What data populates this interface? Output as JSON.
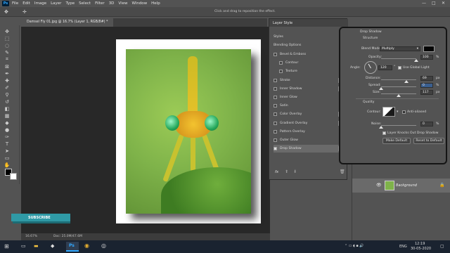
{
  "menu": {
    "logo": "Ps",
    "items": [
      "File",
      "Edit",
      "Image",
      "Layer",
      "Type",
      "Select",
      "Filter",
      "3D",
      "View",
      "Window",
      "Help"
    ],
    "window_controls": [
      "—",
      "□",
      "✕"
    ]
  },
  "options_bar": {
    "hint": "Click and drag to reposition the effect."
  },
  "document_tab": {
    "label": "Damsel Fly 01.jpg @ 16.7% (Layer 1, RGB/8#) *"
  },
  "status_bar": {
    "zoom": "16.67%",
    "doc": "Doc: 25.0M/47.6M"
  },
  "overlay": {
    "subscribe": "SUBSCRIBE"
  },
  "dialog": {
    "title": "Layer Style",
    "styles_header": "Styles",
    "blending_options": "Blending Options",
    "items": [
      {
        "label": "Bevel & Emboss",
        "checked": false,
        "plus": false
      },
      {
        "label": "Contour",
        "checked": false,
        "plus": false,
        "indent": true
      },
      {
        "label": "Texture",
        "checked": false,
        "plus": false,
        "indent": true
      },
      {
        "label": "Stroke",
        "checked": false,
        "plus": true
      },
      {
        "label": "Inner Shadow",
        "checked": false,
        "plus": true
      },
      {
        "label": "Inner Glow",
        "checked": false,
        "plus": false
      },
      {
        "label": "Satin",
        "checked": false,
        "plus": false
      },
      {
        "label": "Color Overlay",
        "checked": false,
        "plus": true
      },
      {
        "label": "Gradient Overlay",
        "checked": false,
        "plus": true
      },
      {
        "label": "Pattern Overlay",
        "checked": false,
        "plus": false
      },
      {
        "label": "Outer Glow",
        "checked": false,
        "plus": false
      },
      {
        "label": "Drop Shadow",
        "checked": true,
        "plus": true
      }
    ],
    "fx": "fx"
  },
  "drop_shadow": {
    "title": "Drop Shadow",
    "structure": "Structure",
    "blend_mode_label": "Blend Mode:",
    "blend_mode_value": "Multiply",
    "shadow_color": "#050505",
    "opacity_label": "Opacity:",
    "opacity_value": "100",
    "opacity_fraction": 1.0,
    "angle_label": "Angle:",
    "angle_value": "120",
    "use_global_light": "Use Global Light",
    "use_global_light_checked": true,
    "distance_label": "Distance:",
    "distance_value": "69",
    "distance_fraction": 0.72,
    "spread_label": "Spread:",
    "spread_value": "0",
    "spread_fraction": 0.0,
    "size_label": "Size:",
    "size_value": "117",
    "size_fraction": 0.5,
    "unit_percent": "%",
    "unit_px": "px",
    "degree": "°",
    "quality": "Quality",
    "contour_label": "Contour:",
    "anti_aliased": "Anti-aliased",
    "noise_label": "Noise:",
    "noise_value": "0",
    "noise_fraction": 0.0,
    "knocks_out": "Layer Knocks Out Drop Shadow",
    "knocks_out_checked": true,
    "make_default": "Make Default",
    "reset_default": "Reset to Default"
  },
  "layers_panel": {
    "layer_name": "Background"
  },
  "taskbar": {
    "language": "ENG",
    "time": "12:19",
    "date": "30-05-2020"
  }
}
